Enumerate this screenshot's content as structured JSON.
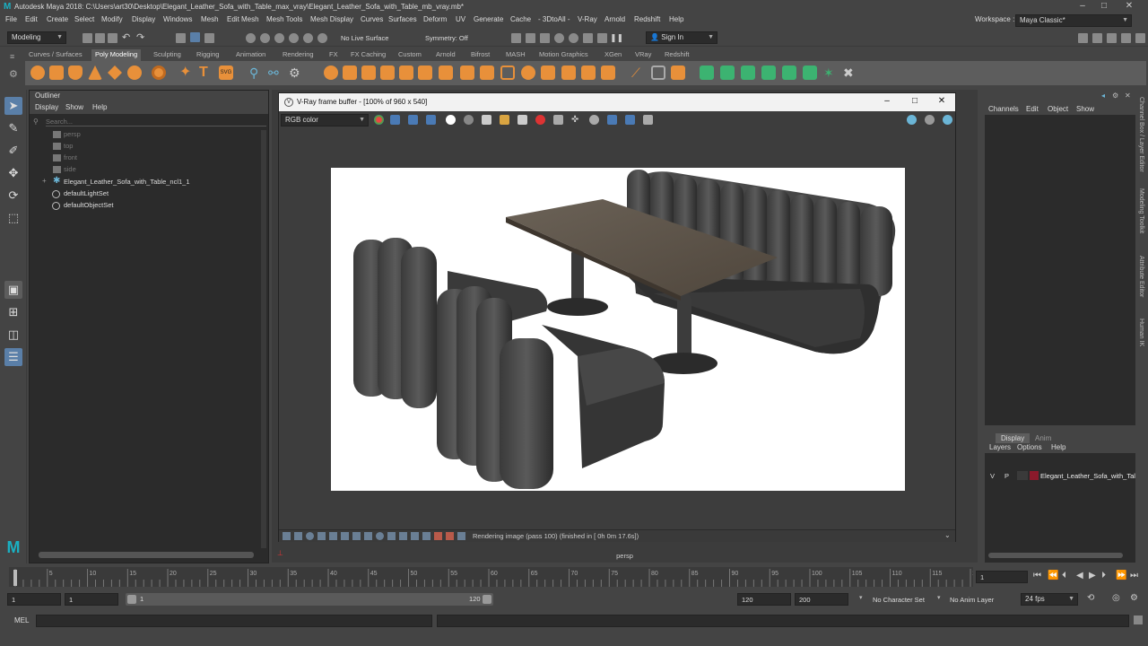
{
  "window": {
    "title": "Autodesk Maya 2018: C:\\Users\\art30\\Desktop\\Elegant_Leather_Sofa_with_Table_max_vray\\Elegant_Leather_Sofa_with_Table_mb_vray.mb*",
    "logo": "M",
    "minimize": "–",
    "restore": "□",
    "close": "✕"
  },
  "workspace": {
    "label": "Workspace :",
    "value": "Maya Classic*"
  },
  "menu": [
    "File",
    "Edit",
    "Create",
    "Select",
    "Modify",
    "Display",
    "Windows",
    "Mesh",
    "Edit Mesh",
    "Mesh Tools",
    "Mesh Display",
    "Curves",
    "Surfaces",
    "Deform",
    "UV",
    "Generate",
    "Cache",
    "- 3DtoAll -",
    "V-Ray",
    "Arnold",
    "Redshift",
    "Help"
  ],
  "statusline": {
    "mode": "Modeling",
    "live_surface": "No Live Surface",
    "symmetry": "Symmetry: Off",
    "sign_in": "Sign In"
  },
  "shelf_tabs": [
    "Curves / Surfaces",
    "Poly Modeling",
    "Sculpting",
    "Rigging",
    "Animation",
    "Rendering",
    "FX",
    "FX Caching",
    "Custom",
    "Arnold",
    "Bifrost",
    "MASH",
    "Motion Graphics",
    "XGen",
    "VRay",
    "Redshift"
  ],
  "shelf_active": "Poly Modeling",
  "outliner": {
    "title": "Outliner",
    "menu": [
      "Display",
      "Show",
      "Help"
    ],
    "search_placeholder": "Search...",
    "items": [
      {
        "label": "persp",
        "dim": true,
        "icon": "camera-icon"
      },
      {
        "label": "top",
        "dim": true,
        "icon": "camera-icon"
      },
      {
        "label": "front",
        "dim": true,
        "icon": "camera-icon"
      },
      {
        "label": "side",
        "dim": true,
        "icon": "camera-icon"
      },
      {
        "label": "Elegant_Leather_Sofa_with_Table_ncl1_1",
        "dim": false,
        "icon": "group-icon"
      },
      {
        "label": "defaultLightSet",
        "dim": false,
        "icon": "set-icon"
      },
      {
        "label": "defaultObjectSet",
        "dim": false,
        "icon": "set-icon"
      }
    ],
    "expand": "+"
  },
  "vfb": {
    "title": "V-Ray frame buffer - [100% of 960 x 540]",
    "channel": "RGB color",
    "status": "Rendering image (pass 100) (finished in [ 0h  0m 17.6s])"
  },
  "viewport": {
    "camera": "persp"
  },
  "channel_box": {
    "menu": [
      "Channels",
      "Edit",
      "Object",
      "Show"
    ]
  },
  "layer_editor": {
    "tabs": [
      "Display",
      "Anim"
    ],
    "menu": [
      "Layers",
      "Options",
      "Help"
    ],
    "layer": {
      "v": "V",
      "p": "P",
      "name": "Elegant_Leather_Sofa_with_Tal",
      "color": "#8b1a2b"
    }
  },
  "side_tabs": [
    "Channel Box / Layer Editor",
    "Modeling Toolkit",
    "Attribute Editor",
    "Human IK"
  ],
  "timeline": {
    "ticks": [
      1,
      5,
      10,
      15,
      20,
      25,
      30,
      35,
      40,
      45,
      50,
      55,
      60,
      65,
      70,
      75,
      80,
      85,
      90,
      95,
      100,
      105,
      110,
      115,
      120
    ],
    "current_frame": "1"
  },
  "range": {
    "start": "1",
    "playback_start": "1",
    "slider_start": "1",
    "slider_end": "120",
    "playback_end": "120",
    "end": "200",
    "character_set": "No Character Set",
    "anim_layer": "No Anim Layer",
    "fps": "24 fps"
  },
  "command": {
    "lang": "MEL"
  },
  "colors": {
    "accent": "#5a7fa8",
    "maya_teal": "#1ab0c2",
    "shelf_bg": "#5d5d5d",
    "panel_dark": "#2b2b2b"
  }
}
